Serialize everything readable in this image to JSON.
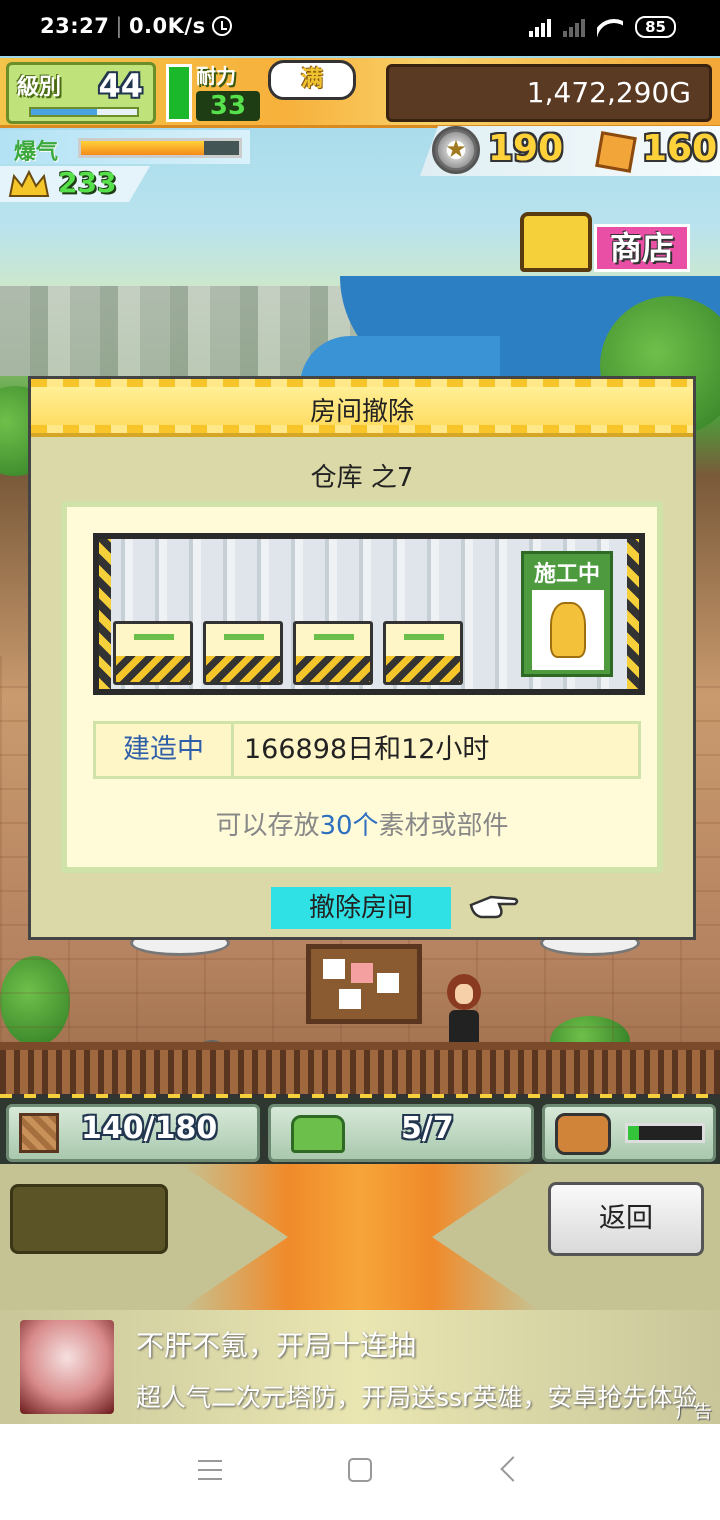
{
  "status_bar": {
    "time": "23:27",
    "speed": "0.0K/s",
    "signal_tag": "HD",
    "battery": "85"
  },
  "hud": {
    "level_label": "級別",
    "level": "44",
    "level_progress": 0.62,
    "stamina_label": "耐力",
    "stamina": "33",
    "stamina_progress": 1.0,
    "stamina_status": "满",
    "gold": "1,472,290G",
    "rage_label": "爆气",
    "rage_progress": 0.78,
    "popularity": "233",
    "medals": "190",
    "materials": "160",
    "shop_label": "商店"
  },
  "dialog": {
    "title": "房间撤除",
    "room_name": "仓库 之7",
    "sign_text": "施工中",
    "status_label": "建造中",
    "status_value": "166898日和12小时",
    "capacity_prefix": "可以存放",
    "capacity_count": "30个",
    "capacity_suffix": "素材或部件",
    "remove_button": "撤除房间"
  },
  "bottom_hud": {
    "storage": "140/180",
    "vehicles": "5/7",
    "pet_progress": 0.15
  },
  "bottom_panel": {
    "back_button": "返回"
  },
  "ad": {
    "title": "不肝不氪，开局十连抽",
    "text": "超人气二次元塔防，开局送ssr英雄，安卓抢先体验",
    "tag": "广告"
  },
  "colors": {
    "dialog_bg": "#dad9a7",
    "header_yellow": "#ffd95a",
    "remove_button": "#2fe0e4",
    "shop_pink": "#ea4fa6",
    "accent_blue": "#2f5fa8"
  }
}
